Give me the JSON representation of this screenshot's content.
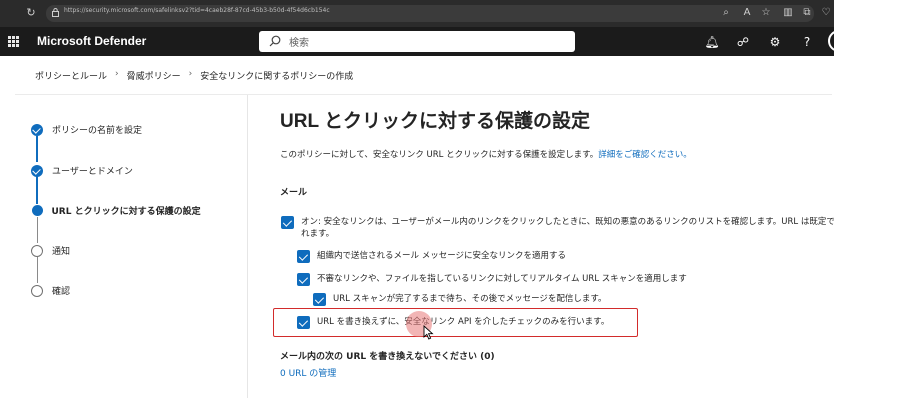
{
  "browser": {
    "url": "https://security.microsoft.com/safelinksv2?tid=4caeb28f-87cd-45b3-b50d-4f54d6cb154c"
  },
  "app": {
    "title": "Microsoft Defender",
    "search_placeholder": "検索"
  },
  "breadcrumb": [
    "ポリシーとルール",
    "脅威ポリシー",
    "安全なリンクに関するポリシーの作成"
  ],
  "steps": [
    {
      "label": "ポリシーの名前を設定",
      "state": "done"
    },
    {
      "label": "ユーザーとドメイン",
      "state": "done"
    },
    {
      "label": "URL とクリックに対する保護の設定",
      "state": "current"
    },
    {
      "label": "通知",
      "state": "todo"
    },
    {
      "label": "確認",
      "state": "todo"
    }
  ],
  "main": {
    "title": "URL とクリックに対する保護の設定",
    "description": "このポリシーに対して、安全なリンク URL とクリックに対する保護を設定します。",
    "learn_more": "詳細をご確認ください。",
    "email_section": "メール",
    "options": [
      {
        "line1": "オン: 安全なリンクは、ユーザーがメール内のリンクをクリックしたときに、既知の悪意のあるリンクのリストを確認します。URL は既定で書き換えら",
        "line2": "れます。",
        "checked": true
      },
      {
        "text": "組織内で送信されるメール メッセージに安全なリンクを適用する",
        "checked": true
      },
      {
        "text": "不審なリンクや、ファイルを指しているリンクに対してリアルタイム URL スキャンを適用します",
        "checked": true
      },
      {
        "text": "URL スキャンが完了するまで待ち、その後でメッセージを配信します。",
        "checked": true
      },
      {
        "text": "URL を書き換えずに、安全なリンク API を介したチェックのみを行います。",
        "checked": true
      }
    ],
    "no_rewrite_title": "メール内の次の URL を書き換えないでください (0)",
    "manage_link": "0 URL の管理"
  },
  "colors": {
    "accent": "#0f6cbd",
    "highlight_border": "#d22b2b",
    "header_bg": "#1b1b1b"
  }
}
